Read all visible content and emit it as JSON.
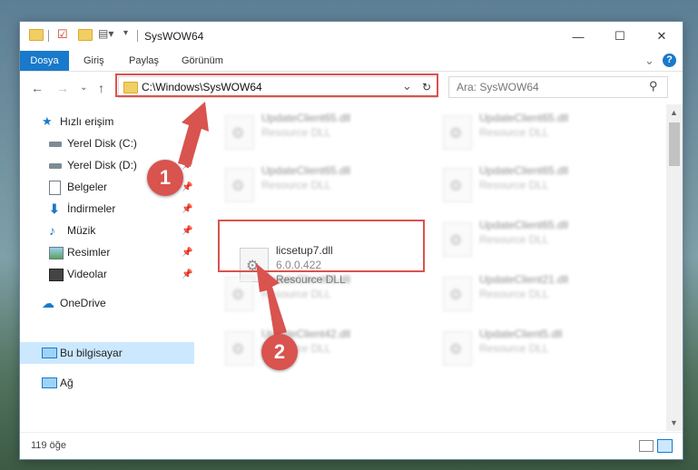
{
  "window": {
    "title": "SysWOW64",
    "controls": {
      "minimize": "—",
      "maximize": "☐",
      "close": "✕"
    }
  },
  "ribbon": {
    "tabs": [
      "Dosya",
      "Giriş",
      "Paylaş",
      "Görünüm"
    ],
    "expand_glyph": "⌄",
    "help_glyph": "?"
  },
  "address": {
    "path": "C:\\Windows\\SysWOW64",
    "dropdown_glyph": "⌄",
    "refresh_glyph": "↻",
    "search_placeholder": "Ara: SysWOW64",
    "search_glyph": "⚲"
  },
  "nav_arrows": {
    "back": "←",
    "forward": "→",
    "recent": "⌄",
    "up": "↑"
  },
  "nav_pane": {
    "items": [
      {
        "label": "Hızlı erişim",
        "pinned": false
      },
      {
        "label": "Yerel Disk (C:)",
        "pinned": true
      },
      {
        "label": "Yerel Disk (D:)",
        "pinned": true
      },
      {
        "label": "Belgeler",
        "pinned": true
      },
      {
        "label": "İndirmeler",
        "pinned": true
      },
      {
        "label": "Müzik",
        "pinned": true
      },
      {
        "label": "Resimler",
        "pinned": true
      },
      {
        "label": "Videolar",
        "pinned": true
      },
      {
        "label": "OneDrive",
        "pinned": false
      },
      {
        "label": "Bu bilgisayar",
        "pinned": false,
        "selected": true
      },
      {
        "label": "Ağ",
        "pinned": false
      }
    ],
    "pin_glyph": "📌"
  },
  "files": {
    "left": [
      {
        "name": "UpdateClient65.dll",
        "type": "Resource DLL"
      },
      {
        "name": "UpdateClient65.dll",
        "type": "Resource DLL"
      },
      {
        "name": "licsetup7.dll",
        "version": "6.0.0.422",
        "type": "Resource DLL",
        "highlighted": true
      },
      {
        "name": "UpdateClient65.dll",
        "type": "Resource DLL"
      },
      {
        "name": "UpdateClient42.dll",
        "type": "Resource DLL"
      }
    ],
    "right": [
      {
        "name": "UpdateClient65.dll",
        "type": "Resource DLL"
      },
      {
        "name": "UpdateClient65.dll",
        "type": "Resource DLL"
      },
      {
        "name": "UpdateClient65.dll",
        "type": "Resource DLL"
      },
      {
        "name": "UpdateClient21.dll",
        "type": "Resource DLL"
      },
      {
        "name": "UpdateClient5.dll",
        "type": "Resource DLL"
      }
    ]
  },
  "status": {
    "count_text": "119 öğe"
  },
  "callouts": {
    "one": "1",
    "two": "2"
  },
  "colors": {
    "accent": "#1979ca",
    "highlight": "#d9534f",
    "selection": "#cce8ff"
  }
}
